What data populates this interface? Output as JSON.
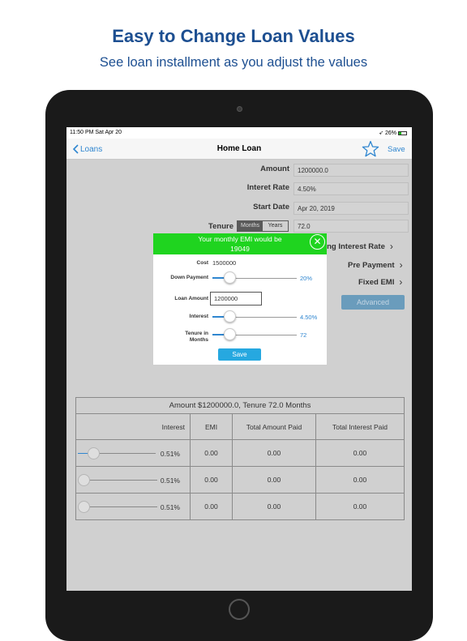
{
  "promo": {
    "headline": "Easy to Change Loan Values",
    "subhead": "See loan installment as you adjust the values"
  },
  "status_bar": {
    "time": "11:50 PM   Sat Apr 20",
    "battery": "26%"
  },
  "nav": {
    "back_label": "Loans",
    "title": "Home Loan",
    "save_label": "Save"
  },
  "form": {
    "amount_label": "Amount",
    "amount_value": "1200000.0",
    "rate_label": "Interet Rate",
    "rate_value": "4.50%",
    "start_label": "Start Date",
    "start_value": "Apr 20, 2019",
    "tenure_label": "Tenure",
    "tenure_options": [
      "Months",
      "Years"
    ],
    "tenure_value": "72.0",
    "floating_label": "ating Interest Rate",
    "prepayment_label": "Pre Payment",
    "fixed_label": "Fixed EMI",
    "advanced_label": "Advanced"
  },
  "popup": {
    "header_line1": "Your  monthly EMI would be",
    "header_line2": "19049",
    "cost_label": "Cost",
    "cost_value": "1500000",
    "down_label": "Down Payment",
    "down_value": "20%",
    "down_fraction": 0.2,
    "loan_label": "Loan Amount",
    "loan_value": "1200000",
    "interest_label": "Interest",
    "interest_value": "4.50%",
    "tenure_label_1": "Tenure in",
    "tenure_label_2": "Months",
    "tenure_value": "72",
    "save_label": "Save"
  },
  "table": {
    "caption": "Amount $1200000.0, Tenure 72.0 Months",
    "headers": [
      "Interest",
      "EMI",
      "Total Amount Paid",
      "Total Interest Paid"
    ],
    "rows": [
      {
        "interest": "0.51%",
        "emi": "0.00",
        "total": "0.00",
        "total_interest": "0.00"
      },
      {
        "interest": "0.51%",
        "emi": "0.00",
        "total": "0.00",
        "total_interest": "0.00"
      },
      {
        "interest": "0.51%",
        "emi": "0.00",
        "total": "0.00",
        "total_interest": "0.00"
      }
    ]
  },
  "colors": {
    "accent": "#2f86d0",
    "headline": "#1d4f91",
    "popup_header": "#1fd41f",
    "save_button": "#26a8e0"
  }
}
